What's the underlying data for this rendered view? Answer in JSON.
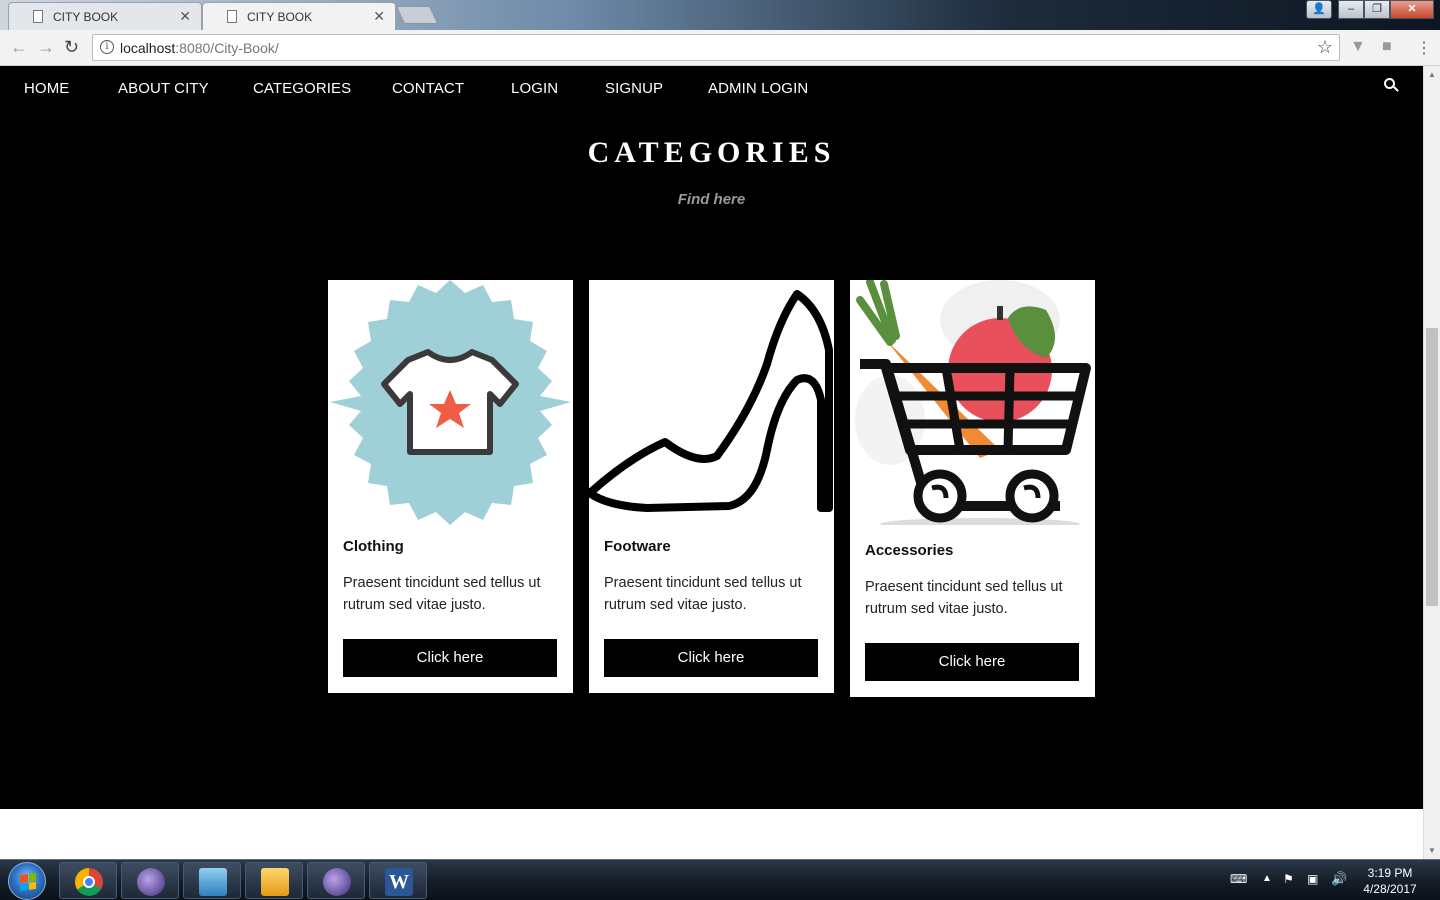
{
  "browser": {
    "tabs": [
      {
        "title": "CITY BOOK",
        "active": false
      },
      {
        "title": "CITY BOOK",
        "active": true
      }
    ],
    "url_host": "localhost",
    "url_path": ":8080/City-Book/"
  },
  "nav": {
    "items": [
      "HOME",
      "ABOUT CITY",
      "CATEGORIES",
      "CONTACT",
      "LOGIN",
      "SIGNUP",
      "ADMIN LOGIN"
    ]
  },
  "section": {
    "title": "CATEGORIES",
    "subtitle": "Find here"
  },
  "cards": [
    {
      "title": "Clothing",
      "description": "Praesent tincidunt sed tellus ut rutrum sed vitae justo.",
      "button": "Click here",
      "icon": "tshirt-icon"
    },
    {
      "title": "Footware",
      "description": "Praesent tincidunt sed tellus ut rutrum sed vitae justo.",
      "button": "Click here",
      "icon": "high-heel-shoe-icon"
    },
    {
      "title": "Accessories",
      "description": "Praesent tincidunt sed tellus ut rutrum sed vitae justo.",
      "button": "Click here",
      "icon": "shopping-cart-icon"
    }
  ],
  "colors": {
    "badge": "#9fd0d8",
    "star": "#f05d45",
    "carrot": "#f08a33",
    "apple": "#e8505b",
    "leaf": "#5a8f3e"
  },
  "taskbar": {
    "apps": [
      "chrome",
      "eclipse",
      "outlook-lync",
      "outlook",
      "eclipse",
      "word"
    ],
    "time": "3:19 PM",
    "date": "4/28/2017"
  }
}
